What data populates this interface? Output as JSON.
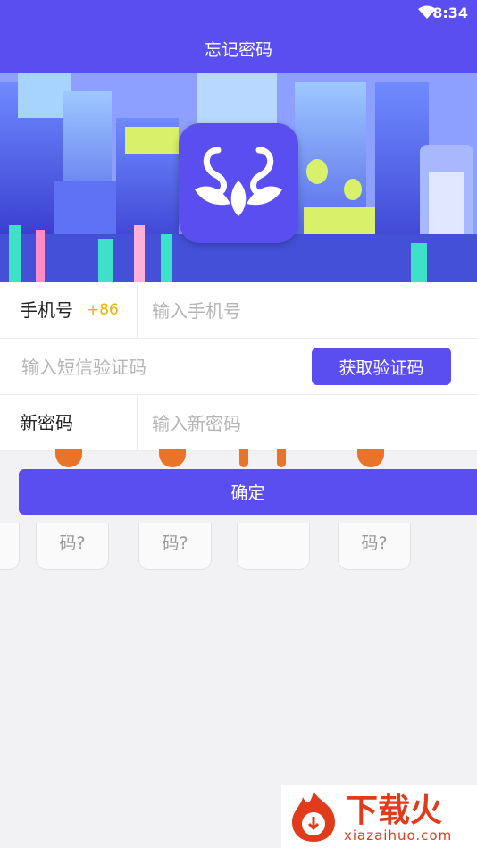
{
  "status_bar": {
    "time": "8:34",
    "wifi_icon": "wifi-icon"
  },
  "title": "忘记密码",
  "form": {
    "phone": {
      "label": "手机号",
      "country_code": "+86",
      "placeholder": "输入手机号",
      "value": ""
    },
    "sms": {
      "placeholder": "输入短信验证码",
      "value": "",
      "button_label": "获取验证码"
    },
    "password": {
      "label": "新密码",
      "placeholder": "输入新密码",
      "value": ""
    }
  },
  "confirm_label": "确定",
  "background_cards": [
    "码?",
    "码?",
    "码?"
  ],
  "watermark": {
    "brand": "下载火",
    "url": "xiazaihuo.com"
  },
  "colors": {
    "accent": "#5b4ef0",
    "country_code": "#e8b400",
    "watermark": "#e23b1c"
  }
}
